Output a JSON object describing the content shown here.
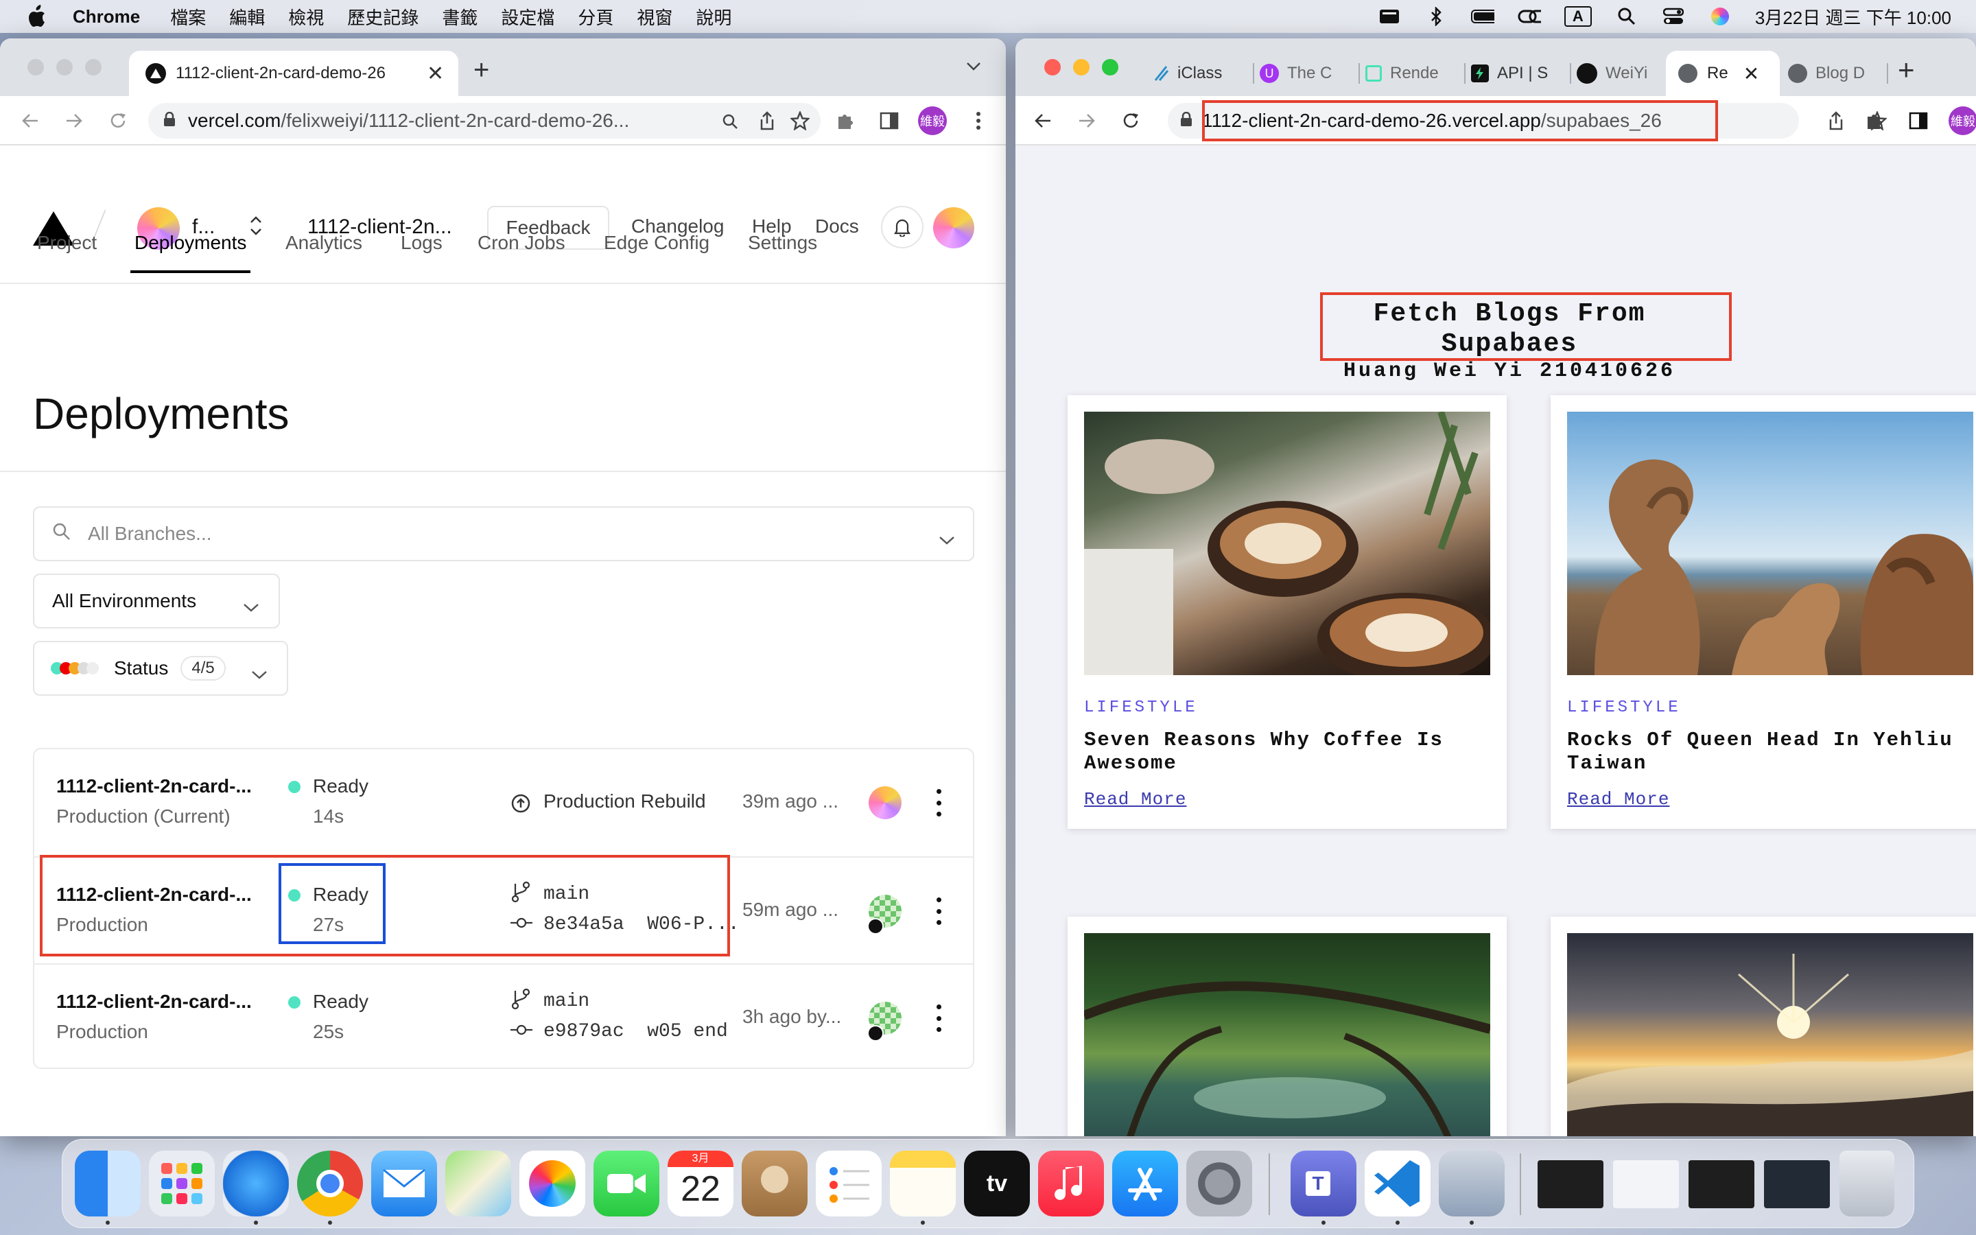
{
  "menubar": {
    "app": "Chrome",
    "items": [
      "檔案",
      "編輯",
      "檢視",
      "歷史記錄",
      "書籤",
      "設定檔",
      "分頁",
      "視窗",
      "說明"
    ],
    "clock": "3月22日 週三 下午 10:00",
    "input_badge": "A"
  },
  "left_browser": {
    "tab_title": "1112-client-2n-card-demo-26",
    "url_host": "vercel.com",
    "url_path": "/felixweiyi/1112-client-2n-card-demo-26...",
    "profile_label": "維毅"
  },
  "vercel": {
    "team": "f...",
    "project": "1112-client-2n...",
    "feedback": "Feedback",
    "links": [
      "Changelog",
      "Help",
      "Docs"
    ],
    "tabs": [
      "Project",
      "Deployments",
      "Analytics",
      "Logs",
      "Cron Jobs",
      "Edge Config",
      "Settings"
    ],
    "title": "Deployments",
    "branch_placeholder": "All Branches...",
    "env_filter": "All Environments",
    "status_label": "Status",
    "status_count": "4/5",
    "deployments": [
      {
        "name": "1112-client-2n-card-...",
        "env": "Production (Current)",
        "state": "Ready",
        "duration": "14s",
        "source": "Production Rebuild",
        "commit": "",
        "time": "39m ago ..."
      },
      {
        "name": "1112-client-2n-card-...",
        "env": "Production",
        "state": "Ready",
        "duration": "27s",
        "branch": "main",
        "commit": "8e34a5a  W06-P...",
        "time": "59m ago ..."
      },
      {
        "name": "1112-client-2n-card-...",
        "env": "Production",
        "state": "Ready",
        "duration": "25s",
        "branch": "main",
        "commit": "e9879ac  w05 end",
        "time": "3h ago by..."
      }
    ],
    "colors": {
      "ready": "#50e3c2",
      "highlight_red": "#e4402d",
      "highlight_blue": "#1b4ed8"
    }
  },
  "right_browser": {
    "tabs": [
      "iClass",
      "The C",
      "Rende",
      "API | S",
      "WeiYi",
      "Re",
      "Blog D"
    ],
    "url_host": "1112-client-2n-card-demo-26.vercel.app",
    "url_path": "/supabaes_26",
    "profile_label": "維毅"
  },
  "blog": {
    "title": "Fetch Blogs From Supabaes",
    "subtitle": "Huang Wei Yi 210410626",
    "cards": [
      {
        "category": "LIFESTYLE",
        "title": "Seven Reasons Why Coffee Is Awesome",
        "link": "Read More",
        "image": "coffee-photo"
      },
      {
        "category": "LIFESTYLE",
        "title": "Rocks Of Queen Head In Yehliu Taiwan",
        "link": "Read More",
        "image": "rock-formation-photo"
      },
      {
        "category": "",
        "title": "",
        "link": "",
        "image": "mangrove-tunnel-photo"
      },
      {
        "category": "",
        "title": "",
        "link": "",
        "image": "sunrise-mountains-photo"
      }
    ]
  },
  "dock": {
    "apps": [
      "Finder",
      "Launchpad",
      "Safari",
      "Chrome",
      "Mail",
      "Maps",
      "Photos",
      "FaceTime",
      "Calendar",
      "Contacts",
      "Reminders",
      "Notes",
      "TV",
      "Music",
      "App Store",
      "System Settings",
      "Teams",
      "VS Code",
      "Preview"
    ],
    "calendar_month": "3月",
    "calendar_day": "22",
    "tv_label": "tv"
  }
}
